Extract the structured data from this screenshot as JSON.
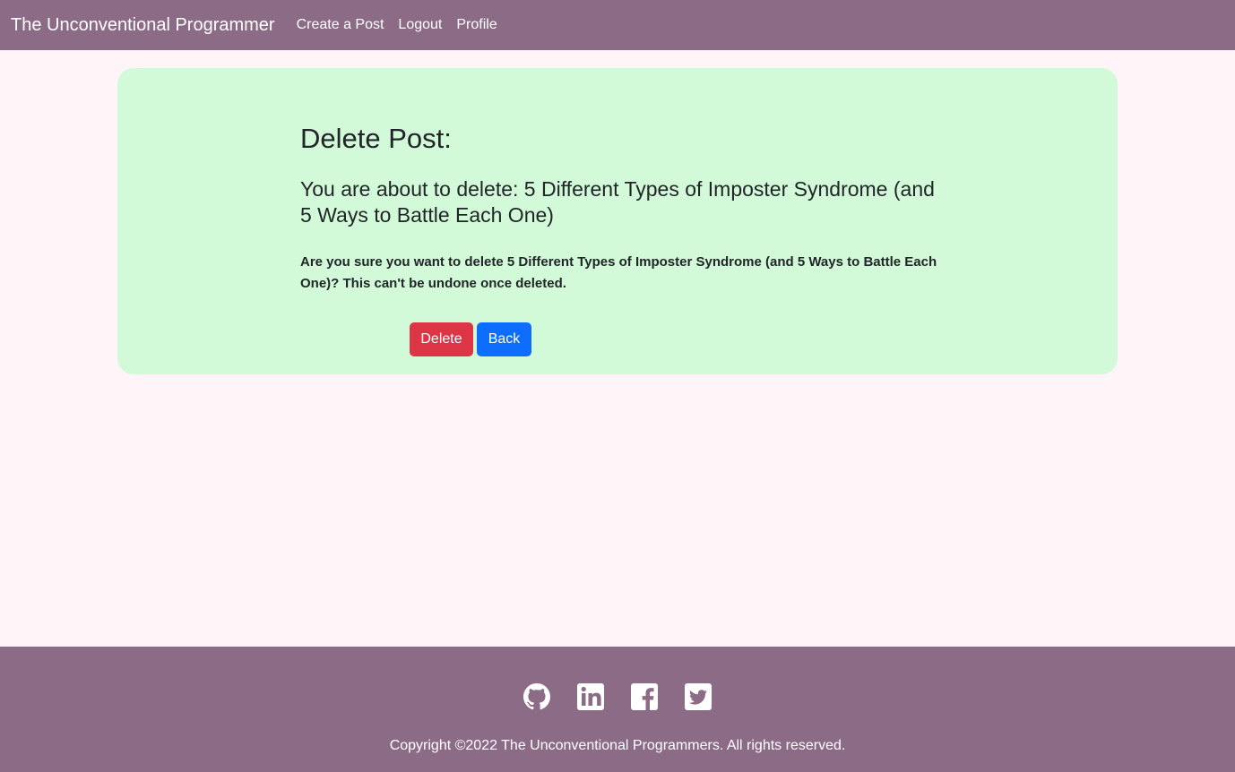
{
  "navbar": {
    "brand": "The Unconventional Programmer",
    "links": [
      "Create a Post",
      "Logout",
      "Profile"
    ]
  },
  "main": {
    "title": "Delete Post:",
    "subtitle": "You are about to delete: 5 Different Types of Imposter Syndrome (and 5 Ways to Battle Each One)",
    "confirm": "Are you sure you want to delete 5 Different Types of Imposter Syndrome (and 5 Ways to Battle Each One)? This can't be undone once deleted.",
    "delete_label": "Delete",
    "back_label": "Back"
  },
  "footer": {
    "social_icons": [
      "github-icon",
      "linkedin-icon",
      "facebook-icon",
      "twitter-icon"
    ],
    "copyright": "Copyright ©2022 The Unconventional Programmers. All rights reserved."
  },
  "colors": {
    "nav_bg": "#8c6b87",
    "page_bg": "#fff5f8",
    "card_bg": "#d3fad8",
    "delete": "#dc3545",
    "back": "#0d6efd"
  }
}
